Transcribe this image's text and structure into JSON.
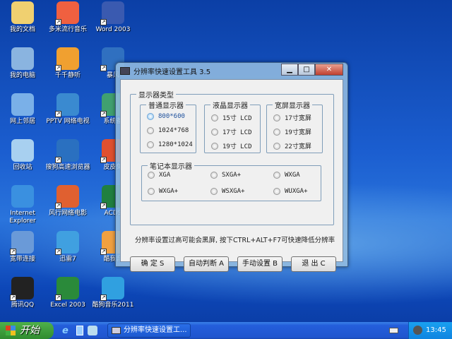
{
  "desktop": {
    "icons": [
      {
        "label": "我的文档",
        "color": "#f0d070",
        "shortcut": false
      },
      {
        "label": "我的电脑",
        "color": "#8ab4e0",
        "shortcut": false
      },
      {
        "label": "网上邻居",
        "color": "#7ab0e8",
        "shortcut": false
      },
      {
        "label": "回收站",
        "color": "#a8d0f0",
        "shortcut": false
      },
      {
        "label": "Internet Explorer",
        "color": "#3a90e0",
        "shortcut": false
      },
      {
        "label": "宽带连接",
        "color": "#6a9ad8",
        "shortcut": true
      },
      {
        "label": "腾讯QQ",
        "color": "#222222",
        "shortcut": true
      },
      {
        "label": "多米流行音乐",
        "color": "#f06040",
        "shortcut": true
      },
      {
        "label": "千千静听",
        "color": "#f0a030",
        "shortcut": true
      },
      {
        "label": "PPTV 网络电视",
        "color": "#3a8ad0",
        "shortcut": true
      },
      {
        "label": "搜狗高速浏览器",
        "color": "#2a70c0",
        "shortcut": true
      },
      {
        "label": "风行网络电影",
        "color": "#e06030",
        "shortcut": true
      },
      {
        "label": "迅雷7",
        "color": "#40a0e0",
        "shortcut": true
      },
      {
        "label": "Excel 2003",
        "color": "#2a8a3a",
        "shortcut": true
      },
      {
        "label": "Word 2003",
        "color": "#3a5ab0",
        "shortcut": true
      },
      {
        "label": "暴风",
        "color": "#3070c0",
        "shortcut": true
      },
      {
        "label": "系统备",
        "color": "#40a070",
        "shortcut": true
      },
      {
        "label": "皮皮免",
        "color": "#e05030",
        "shortcut": true
      },
      {
        "label": "ACDS",
        "color": "#208040",
        "shortcut": true
      },
      {
        "label": "酷我音",
        "color": "#f0a040",
        "shortcut": true
      },
      {
        "label": "酷狗音乐2011",
        "color": "#30a0e0",
        "shortcut": true
      }
    ]
  },
  "window": {
    "title": "分辨率快速设置工具 3.5",
    "minimize": "▁",
    "maximize": "□",
    "close": "✕",
    "group_main": "显示器类型",
    "groups": [
      {
        "legend": "普通显示器",
        "options": [
          "800*600",
          "1024*768",
          "1280*1024"
        ]
      },
      {
        "legend": "液晶显示器",
        "options": [
          "15寸 LCD",
          "17寸 LCD",
          "19寸 LCD"
        ]
      },
      {
        "legend": "宽屏显示器",
        "options": [
          "17寸宽屏",
          "19寸宽屏",
          "22寸宽屏"
        ]
      }
    ],
    "laptop": {
      "legend": "笔记本显示器",
      "options": [
        "XGA",
        "SXGA+",
        "WXGA",
        "WXGA+",
        "WSXGA+",
        "WUXGA+"
      ]
    },
    "selected": "800*600",
    "note": "分辨率设置过高可能会黑屏, 按下CTRL+ALT+F7可快速降低分辨率",
    "buttons": [
      "确 定 S",
      "自动判断 A",
      "手动设置 B",
      "退 出 C"
    ]
  },
  "taskbar": {
    "start": "开始",
    "task": "分辨率快速设置工...",
    "clock": "13:45"
  }
}
